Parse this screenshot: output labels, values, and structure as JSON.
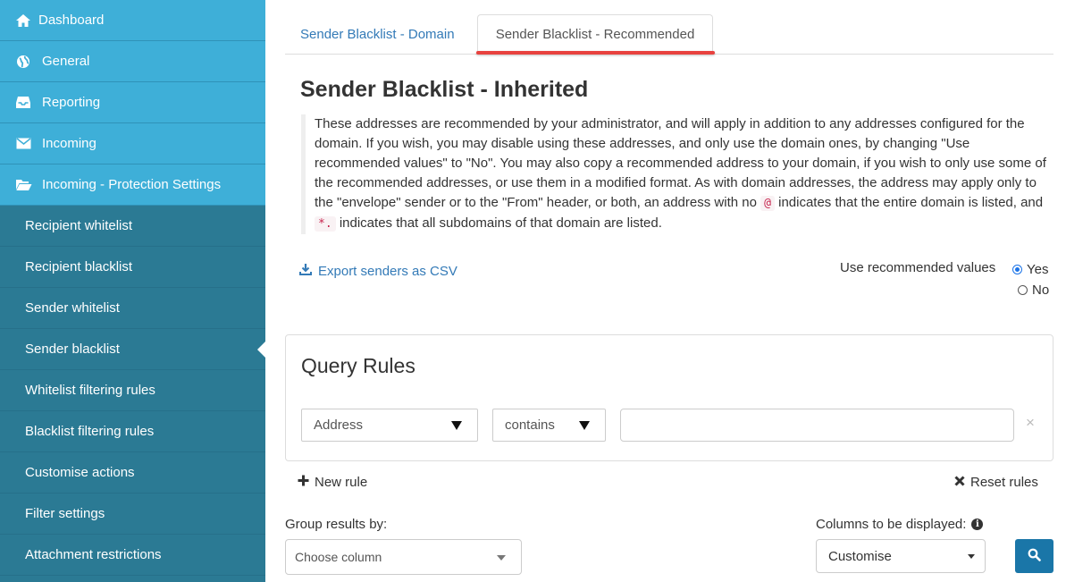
{
  "sidebar": {
    "top_items": [
      {
        "label": "Dashboard",
        "icon": "home-icon"
      },
      {
        "label": "General",
        "icon": "globe-icon"
      },
      {
        "label": "Reporting",
        "icon": "inbox-icon"
      },
      {
        "label": "Incoming",
        "icon": "envelope-icon"
      },
      {
        "label": "Incoming - Protection Settings",
        "icon": "folder-open-icon"
      }
    ],
    "sub_items": [
      {
        "label": "Recipient whitelist"
      },
      {
        "label": "Recipient blacklist"
      },
      {
        "label": "Sender whitelist"
      },
      {
        "label": "Sender blacklist",
        "active": true
      },
      {
        "label": "Whitelist filtering rules"
      },
      {
        "label": "Blacklist filtering rules"
      },
      {
        "label": "Customise actions"
      },
      {
        "label": "Filter settings"
      },
      {
        "label": "Attachment restrictions"
      }
    ]
  },
  "tabs": [
    {
      "label": "Sender Blacklist - Domain",
      "active": false
    },
    {
      "label": "Sender Blacklist - Recommended",
      "active": true
    }
  ],
  "page": {
    "title": "Sender Blacklist - Inherited",
    "description_part1": "These addresses are recommended by your administrator, and will apply in addition to any addresses configured for the domain. If you wish, you may disable using these addresses, and only use the domain ones, by changing \"Use recommended values\" to \"No\". You may also copy a recommended address to your domain, if you wish to only use some of the recommended addresses, or use them in a modified format. As with domain addresses, the address may apply only to the \"envelope\" sender or to the \"From\" header, or both, an address with no",
    "code_at": "@",
    "description_part2": "indicates that the entire domain is listed, and",
    "code_wildcard": "*.",
    "description_part3": "indicates that all subdomains of that domain are listed.",
    "export_label": "Export senders as CSV",
    "use_recommended_label": "Use recommended values",
    "radio_yes": "Yes",
    "radio_no": "No",
    "use_recommended_value": "Yes"
  },
  "query": {
    "title": "Query Rules",
    "field_select": "Address",
    "operator_select": "contains",
    "value": "",
    "remove_symbol": "×",
    "new_rule_label": "New rule",
    "reset_rules_label": "Reset rules"
  },
  "grouping": {
    "label": "Group results by:",
    "placeholder": "Choose column"
  },
  "columns": {
    "label": "Columns to be displayed:",
    "select_value": "Customise"
  },
  "colors": {
    "sidebar_top": "#3eafd8",
    "sidebar_sub": "#2b7a94",
    "link": "#337ab7",
    "tab_underline": "#e8423f",
    "search_button": "#1a76a8"
  }
}
